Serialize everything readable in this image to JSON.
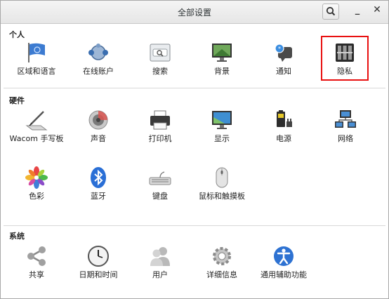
{
  "window": {
    "title": "全部设置"
  },
  "sections": {
    "personal": "个人",
    "hardware": "硬件",
    "system": "系统"
  },
  "personal": [
    "区域和语言",
    "在线账户",
    "搜索",
    "背景",
    "通知",
    "隐私"
  ],
  "hardware": [
    "Wacom 手写板",
    "声音",
    "打印机",
    "显示",
    "电源",
    "网络",
    "色彩",
    "蓝牙",
    "键盘",
    "鼠标和触摸板"
  ],
  "system": [
    "共享",
    "日期和时间",
    "用户",
    "详细信息",
    "通用辅助功能"
  ],
  "highlight": {
    "item": "隐私",
    "color": "#e81010"
  }
}
